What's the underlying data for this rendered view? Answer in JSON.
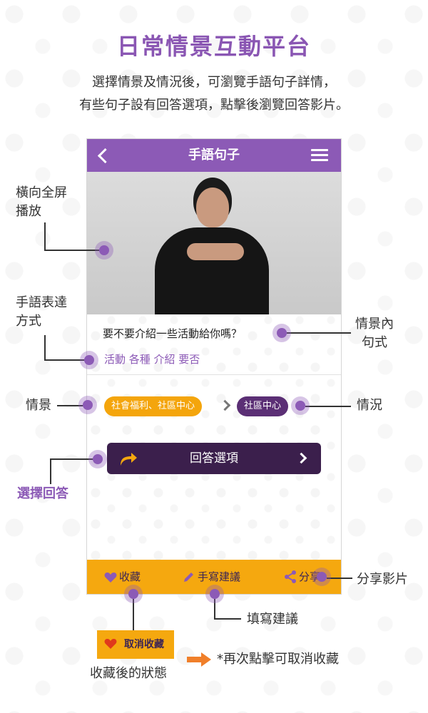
{
  "page": {
    "title": "日常情景互動平台",
    "intro_line1": "選擇情景及情況後，可瀏覽手語句子詳情，",
    "intro_line2": "有些句子設有回答選項，點擊後瀏覽回答影片。"
  },
  "app": {
    "title": "手語句子",
    "sentence": "要不要介紹一些活動給你嗎？",
    "expression": "活動 各種 介紹 要否",
    "scene_chip": "社會福利、社區中心",
    "situation_chip": "社區中心",
    "answer_button": "回答選項",
    "bottom_bar": {
      "favorite": "收藏",
      "suggest": "手寫建議",
      "share": "分享"
    }
  },
  "annotations": {
    "landscape_fullscreen": "橫向全屏\n播放",
    "sign_expression": "手語表達\n方式",
    "scene": "情景",
    "choose_answer": "選擇回答",
    "sentence_pattern": "情景內\n句式",
    "situation": "情況",
    "share_video": "分享影片",
    "fill_suggestion": "填寫建議",
    "favorited_state": "收藏後的狀態",
    "unfavorite_note": "*再次點擊可取消收藏",
    "unfavorite_chip": "取消收藏"
  },
  "colors": {
    "purple": "#8c5ab6",
    "dark_purple": "#3b1f4c",
    "orange": "#f5a80f",
    "arrow_orange": "#f07f2a"
  }
}
